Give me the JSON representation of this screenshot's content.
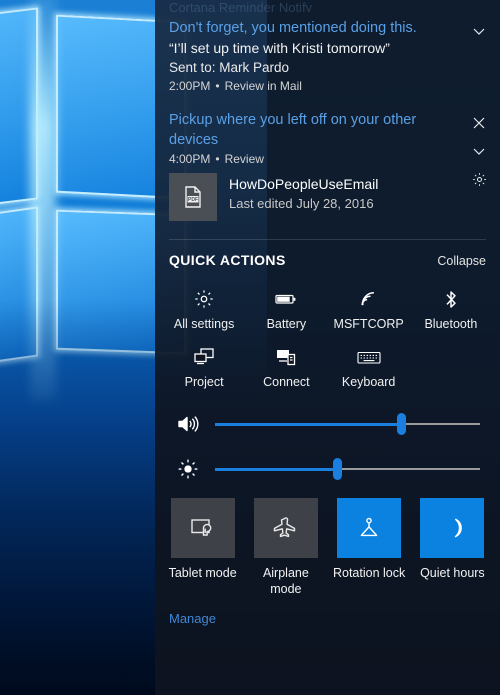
{
  "desktop": {
    "wallpaper_name": "windows-hero-wallpaper"
  },
  "action_center": {
    "clipped_top_text": "Cortana Reminder Notify",
    "notifications": [
      {
        "title": "Don't forget, you mentioned doing this.",
        "quote": "“I’ll set up time with Kristi tomorrow”",
        "sent_to": "Sent to: Mark Pardo",
        "time": "2:00PM",
        "separator": "•",
        "action": "Review in Mail",
        "expand_icon": "chevron-down-icon"
      },
      {
        "title": "Pickup where you left off on your other devices",
        "time": "4:00PM",
        "separator": "•",
        "action": "Review",
        "doc_icon": "pdf-file-icon",
        "doc_name": "HowDoPeopleUseEmail",
        "doc_edited": "Last edited July 28, 2016",
        "close_icon": "close-icon",
        "expand_icon": "chevron-down-icon",
        "settings_icon": "gear-icon"
      }
    ],
    "quick_actions": {
      "title": "QUICK ACTIONS",
      "collapse_label": "Collapse",
      "items": [
        {
          "label": "All settings",
          "icon": "gear-icon"
        },
        {
          "label": "Battery",
          "icon": "battery-icon"
        },
        {
          "label": "MSFTCORP",
          "icon": "wifi-icon"
        },
        {
          "label": "Bluetooth",
          "icon": "bluetooth-icon"
        },
        {
          "label": "Project",
          "icon": "project-screens-icon"
        },
        {
          "label": "Connect",
          "icon": "connect-display-icon"
        },
        {
          "label": "Keyboard",
          "icon": "keyboard-icon"
        }
      ]
    },
    "sliders": [
      {
        "name": "volume",
        "icon": "speaker-icon",
        "value": 70
      },
      {
        "name": "brightness",
        "icon": "brightness-sun-icon",
        "value": 46
      }
    ],
    "tiles": [
      {
        "label": "Tablet mode",
        "icon": "tablet-mode-icon",
        "active": false
      },
      {
        "label": "Airplane mode",
        "icon": "airplane-icon",
        "active": false
      },
      {
        "label": "Rotation lock",
        "icon": "rotation-lock-icon",
        "active": true
      },
      {
        "label": "Quiet hours",
        "icon": "moon-icon",
        "active": true
      }
    ],
    "manage_label": "Manage",
    "colors": {
      "accent_blue": "#0c82e0",
      "tile_inactive": "#3e4248",
      "link_blue": "#3f86d4",
      "title_blue": "#5aa0e6",
      "panel_bg": "#0e1420"
    }
  }
}
